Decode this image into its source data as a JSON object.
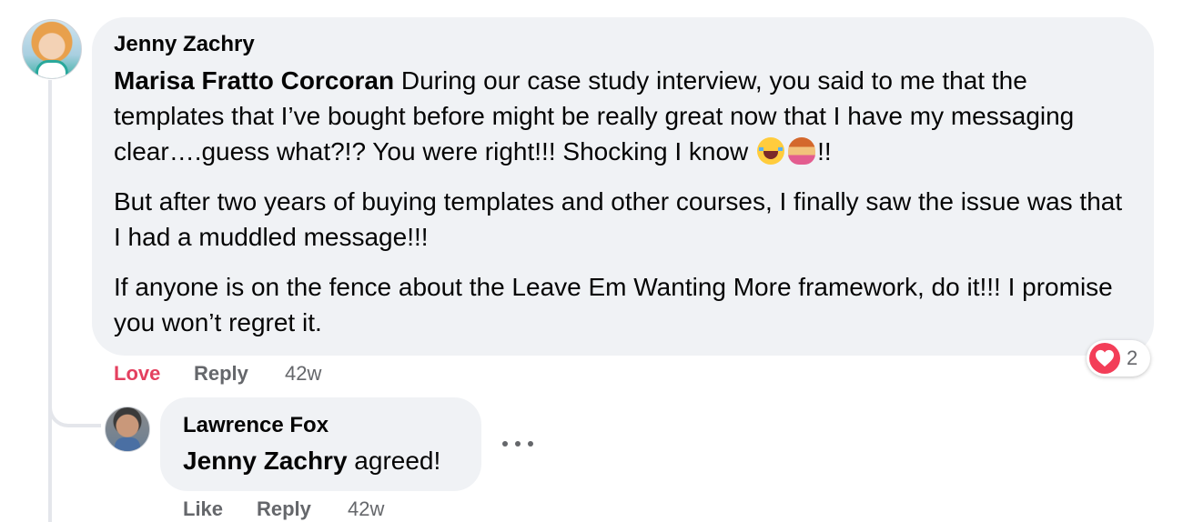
{
  "comment": {
    "author": "Jenny Zachry",
    "mention": "Marisa Fratto Corcoran",
    "paragraph1_a": " During our case study interview, you said to me that the templates that I’ve bought before might be really great now that I have my messaging clear….guess what?!? You were right!!! Shocking I know ",
    "paragraph1_b": "!!",
    "emoji1": "face-with-tears-of-joy",
    "emoji2": "woman-facepalming",
    "paragraph2": "But after two years of buying templates and other courses, I finally saw the issue was that I had a muddled message!!!",
    "paragraph3": "If anyone is on the fence about the Leave Em Wanting More framework, do it!!! I promise you won’t regret it.",
    "actions": {
      "love_label": "Love",
      "reply_label": "Reply",
      "time": "42w"
    },
    "reaction": {
      "icon": "heart-icon",
      "color": "#f33e58",
      "count": "2"
    }
  },
  "reply": {
    "author": "Lawrence Fox",
    "mention": "Jenny Zachry",
    "text": " agreed!",
    "actions": {
      "like_label": "Like",
      "reply_label": "Reply",
      "time": "42w"
    }
  },
  "colors": {
    "bubble": "#f0f2f5",
    "love": "#e4405f",
    "secondary_text": "#65676b"
  }
}
